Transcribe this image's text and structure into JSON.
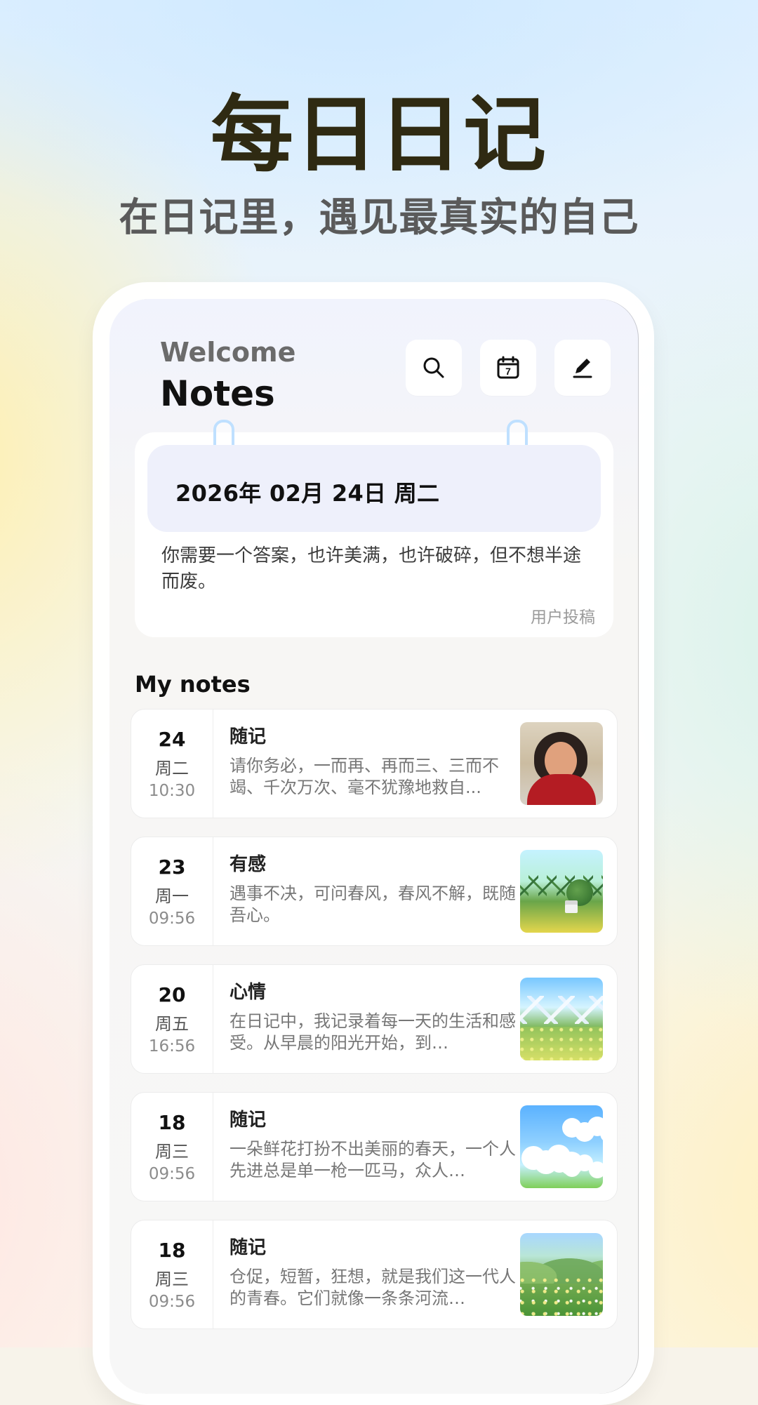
{
  "hero": {
    "title": "每日日记",
    "subtitle": "在日记里，遇见最真实的自己"
  },
  "header": {
    "welcome": "Welcome",
    "title": "Notes"
  },
  "actions": {
    "search_icon": "search-icon",
    "calendar_icon": "calendar-icon",
    "edit_icon": "edit-icon",
    "calendar_day": "7"
  },
  "date_card": {
    "date_text": "2026年  02月  24日     周二",
    "quote": "你需要一个答案，也许美满，也许破碎，但不想半途而废。",
    "author": "用户投稿"
  },
  "section": {
    "title": "My  notes"
  },
  "notes": [
    {
      "day": "24",
      "weekday": "周二",
      "time": "10:30",
      "title": "随记",
      "text": "请你务必，一而再、再而三、三而不竭、千次万次、毫不犹豫地救自..."
    },
    {
      "day": "23",
      "weekday": "周一",
      "time": "09:56",
      "title": "有感",
      "text": "遇事不决，可问春风，春风不解，既随吾心。"
    },
    {
      "day": "20",
      "weekday": "周五",
      "time": "16:56",
      "title": "心情",
      "text": "在日记中，我记录着每一天的生活和感受。从早晨的阳光开始，到…"
    },
    {
      "day": "18",
      "weekday": "周三",
      "time": "09:56",
      "title": "随记",
      "text": "一朵鲜花打扮不出美丽的春天，一个人先进总是单一枪一匹马，众人…"
    },
    {
      "day": "18",
      "weekday": "周三",
      "time": "09:56",
      "title": "随记",
      "text": "仓促，短暂，狂想，就是我们这一代人的青春。它们就像一条条河流…"
    }
  ]
}
